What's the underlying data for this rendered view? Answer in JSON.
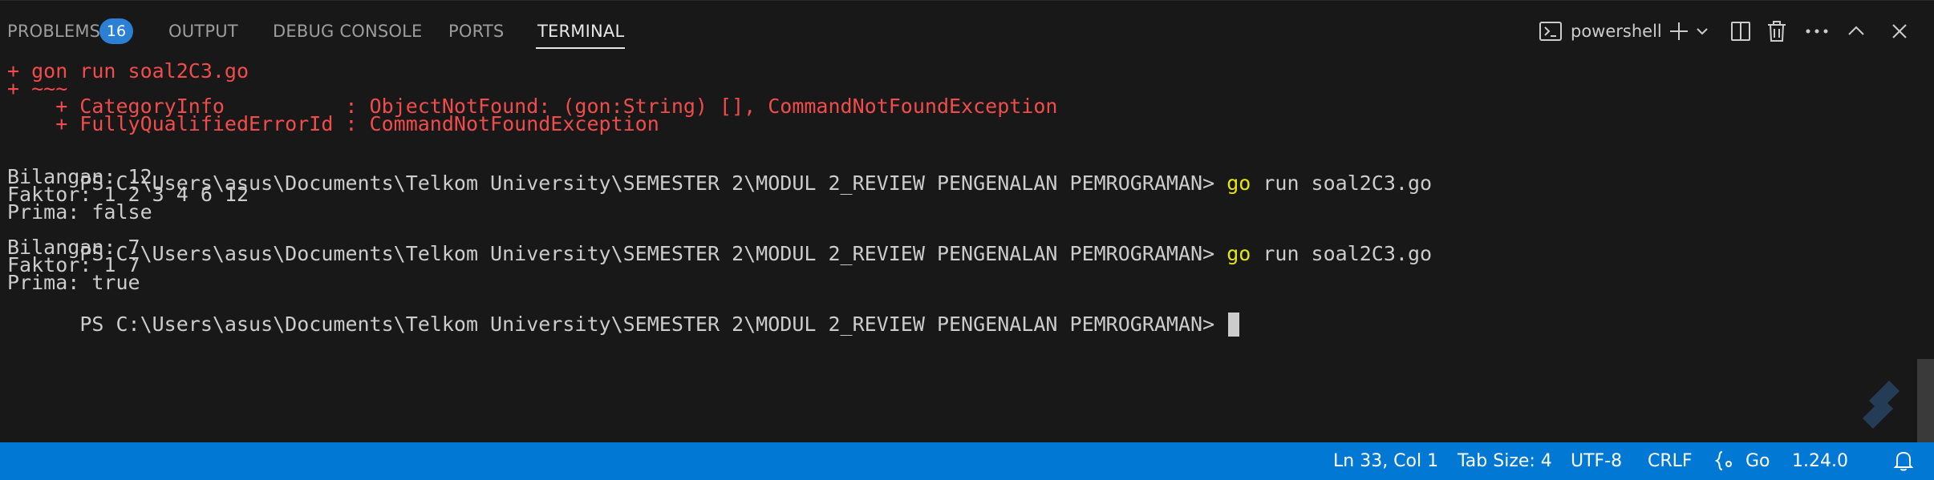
{
  "panel_tabs": {
    "problems": "PROBLEMS",
    "problems_count": "16",
    "output": "OUTPUT",
    "debug_console": "DEBUG CONSOLE",
    "ports": "PORTS",
    "terminal": "TERMINAL"
  },
  "toolbar": {
    "shell_name": "powershell",
    "icons": [
      "terminal-icon",
      "plus-icon",
      "chevron-down-icon",
      "split-icon",
      "trash-icon",
      "more-icon",
      "chevron-up-icon",
      "close-icon"
    ]
  },
  "terminal": {
    "lines": {
      "l1": "+ gon run soal2C3.go",
      "l2": "+ ~~~",
      "l3": "    + CategoryInfo          : ObjectNotFound: (gon:String) [], CommandNotFoundException",
      "l4": "    + FullyQualifiedErrorId : CommandNotFoundException",
      "p1_prompt": "PS C:\\Users\\asus\\Documents\\Telkom University\\SEMESTER 2\\MODUL 2_REVIEW PENGENALAN PEMROGRAMAN> ",
      "p1_cmd": "go",
      "p1_args": " run soal2C3.go",
      "o1": "Bilangan: 12",
      "o2": "Faktor: 1 2 3 4 6 12",
      "o3": "Prima: false",
      "p2_prompt": "PS C:\\Users\\asus\\Documents\\Telkom University\\SEMESTER 2\\MODUL 2_REVIEW PENGENALAN PEMROGRAMAN> ",
      "p2_cmd": "go",
      "p2_args": " run soal2C3.go",
      "o4": "Bilangan: 7",
      "o5": "Faktor: 1 7",
      "o6": "Prima: true",
      "p3_prompt": "PS C:\\Users\\asus\\Documents\\Telkom University\\SEMESTER 2\\MODUL 2_REVIEW PENGENALAN PEMROGRAMAN> "
    },
    "colors": {
      "error": "#f14c4c",
      "normal": "#cccccc",
      "command": "#e5e510"
    }
  },
  "statusbar": {
    "position": "Ln 33, Col 1",
    "tab_size": "Tab Size: 4",
    "encoding": "UTF-8",
    "eol": "CRLF",
    "language": "Go",
    "version": "1.24.0",
    "background": "#0078d4"
  }
}
